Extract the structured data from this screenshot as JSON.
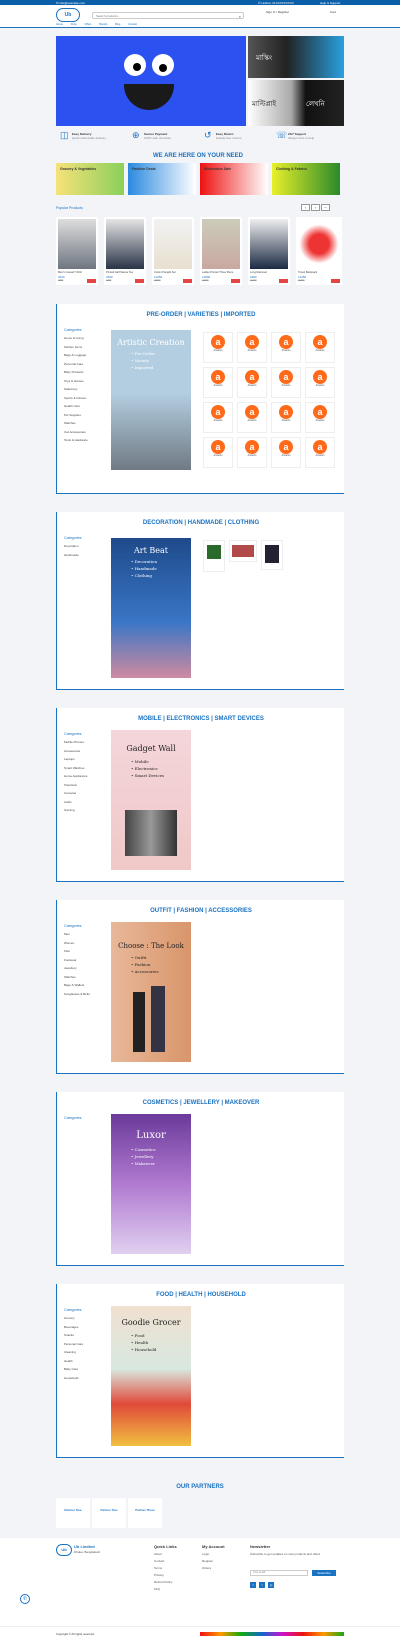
{
  "topbar": {
    "contact": "✉ info@example.com",
    "hotline": "✆ Hotline: 01XXXXXXXXX",
    "help": "Help & Support"
  },
  "header": {
    "logo": "Ub",
    "search_placeholder": "Search products...",
    "account": "Sign In / Register",
    "cart": "Cart"
  },
  "nav": {
    "items": [
      "Home",
      "Shop",
      "Offers",
      "Brands",
      "Blog",
      "Contact"
    ]
  },
  "hero": {
    "tile1": "মাস্কিং",
    "tile2": "মাল্টিপ্লাই",
    "tile3": "লেখনি"
  },
  "features": [
    {
      "title": "Easy Delivery",
      "sub": "Quick nationwide delivery"
    },
    {
      "title": "Secure Payment",
      "sub": "100% safe checkout"
    },
    {
      "title": "Easy Return",
      "sub": "Hassle-free returns"
    },
    {
      "title": "24/7 Support",
      "sub": "Always here to help"
    }
  ],
  "need": {
    "title": "WE ARE HERE ON YOUR NEED",
    "cards": [
      "Grocery & Vegetables",
      "Fashion Deals",
      "Electronics Sale",
      "Clothing & Fabrics"
    ]
  },
  "products": {
    "title": "Popular Products",
    "items": [
      {
        "name": "Men's Casual T-Shirt",
        "price": "৳540",
        "old": "৳650"
      },
      {
        "name": "Printed Half Sleeve Tee",
        "price": "৳590",
        "old": "৳700"
      },
      {
        "name": "Cotton Panjabi Set",
        "price": "৳1250",
        "old": "৳1500"
      },
      {
        "name": "Ladies Printed Three Piece",
        "price": "৳1890",
        "old": "৳2200"
      },
      {
        "name": "Long Raincoat",
        "price": "৳980",
        "old": "৳1200"
      },
      {
        "name": "Travel Backpack",
        "price": "৳1450",
        "old": "৳1700"
      }
    ]
  },
  "sections": [
    {
      "title": "PRE-ORDER | VARIETIES | IMPORTED",
      "cats_header": "Categories",
      "cats": [
        "Home & Living",
        "Kitchen Items",
        "Bags & Luggage",
        "Personal Care",
        "Baby Products",
        "Toys & Games",
        "Stationery",
        "Sports & Fitness",
        "Health Care",
        "Pet Supplies",
        "Watches",
        "Car Accessories",
        "Tools & Hardware"
      ],
      "banner_title": "Artistic Creation",
      "banner_lines": [
        "• Pre-Order",
        "• Variety",
        "• Imported"
      ],
      "grid": [
        "Amazon",
        "Amazon",
        "Amazon",
        "Amazon",
        "Amazon",
        "Amazon",
        "Amazon",
        "Amazon",
        "Amazon",
        "Amazon",
        "Amazon",
        "Amazon",
        "Amazon",
        "Amazon",
        "Amazon",
        "Amazon"
      ]
    },
    {
      "title": "DECORATION | HANDMADE | CLOTHING",
      "cats_header": "Categories",
      "cats": [
        "Decoration",
        "Handmade"
      ],
      "banner_title": "Art Beat",
      "banner_lines": [
        "• Decoration",
        "• Handmade",
        "• Clothing"
      ]
    },
    {
      "title": "MOBILE | ELECTRONICS | SMART DEVICES",
      "cats_header": "Categories",
      "cats": [
        "Mobile Phones",
        "Accessories",
        "Laptops",
        "Smart Watches",
        "Home Appliances",
        "Television",
        "Cameras",
        "Audio",
        "Gaming"
      ],
      "banner_title": "Gadget Wall",
      "banner_lines": [
        "• Mobile",
        "• Electronics",
        "• Smart Devices"
      ]
    },
    {
      "title": "OUTFIT | FASHION | ACCESSORIES",
      "cats_header": "Categories",
      "cats": [
        "Men",
        "Women",
        "Kids",
        "Footwear",
        "Jewellery",
        "Watches",
        "Bags & Wallets",
        "Sunglasses & Belts"
      ],
      "banner_title": "Choose : The Look",
      "banner_lines": [
        "• Outfit",
        "• Fashion",
        "• Accessories"
      ]
    },
    {
      "title": "COSMETICS | JEWELLERY | MAKEOVER",
      "cats_header": "Categories",
      "cats": [],
      "banner_title": "Luxor",
      "banner_lines": [
        "• Cosmetics",
        "• Jewellery",
        "• Makeover"
      ]
    },
    {
      "title": "FOOD | HEALTH | HOUSEHOLD",
      "cats_header": "Categories",
      "cats": [
        "Grocery",
        "Beverages",
        "Snacks",
        "Personal Care",
        "Cleaning",
        "Health",
        "Baby Care",
        "Household"
      ],
      "banner_title": "Goodie Grocer",
      "banner_lines": [
        "• Food",
        "• Health",
        "• Household"
      ]
    }
  ],
  "partners": {
    "title": "OUR PARTNERS",
    "items": [
      "Partner One",
      "Partner Two",
      "Partner Three"
    ]
  },
  "footer": {
    "brand": "Ub Limited",
    "address": "Dhaka, Bangladesh",
    "quick_title": "Quick Links",
    "quick": [
      "About",
      "Contact",
      "Terms",
      "Privacy",
      "Refund Policy",
      "FAQ"
    ],
    "account_title": "My Account",
    "account": [
      "Login",
      "Register",
      "Orders"
    ],
    "news_title": "Newsletter",
    "news_text": "Subscribe to get updates on new products and offers.",
    "email_placeholder": "Your email",
    "subscribe": "Subscribe",
    "copyright": "Copyright © All rights reserved."
  }
}
